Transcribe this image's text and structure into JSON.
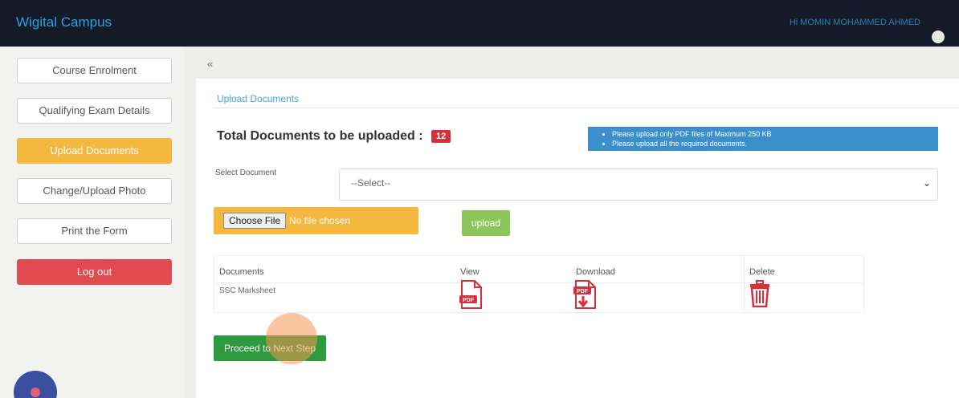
{
  "header": {
    "brand": "Wigital Campus",
    "user_greeting": "Hi MOMIN MOHAMMED AHMED"
  },
  "sidebar": {
    "items": [
      {
        "label": "Course Enrolment"
      },
      {
        "label": "Qualifying Exam Details"
      },
      {
        "label": "Upload Documents"
      },
      {
        "label": "Change/Upload Photo"
      },
      {
        "label": "Print the Form"
      },
      {
        "label": "Log out"
      }
    ],
    "active_index": 2
  },
  "collapse_label": "«",
  "panel": {
    "title": "Upload Documents",
    "total_label": "Total Documents to be uploaded :",
    "total_count": "12",
    "notices": [
      "Please upload only PDF files of Maximum 250 KB",
      "Please upload all the required documents."
    ],
    "select_label": "Select Document",
    "select_value": "--Select--",
    "choose_file_label": "Choose File",
    "no_file_text": "No file chosen",
    "upload_label": "upload",
    "table": {
      "headers": [
        "Documents",
        "View",
        "Download",
        "Delete"
      ],
      "rows": [
        {
          "document": "SSC Marksheet",
          "view_icon": "pdf-icon",
          "download_icon": "pdf-download-icon",
          "delete_icon": "trash-icon"
        }
      ]
    },
    "proceed_label": "Proceed to Next Step"
  },
  "colors": {
    "topbar": "#141a28",
    "active": "#f4b841",
    "danger": "#e24a52",
    "info": "#3b8fcb",
    "success": "#2e9a40",
    "badge": "#d7303c"
  }
}
